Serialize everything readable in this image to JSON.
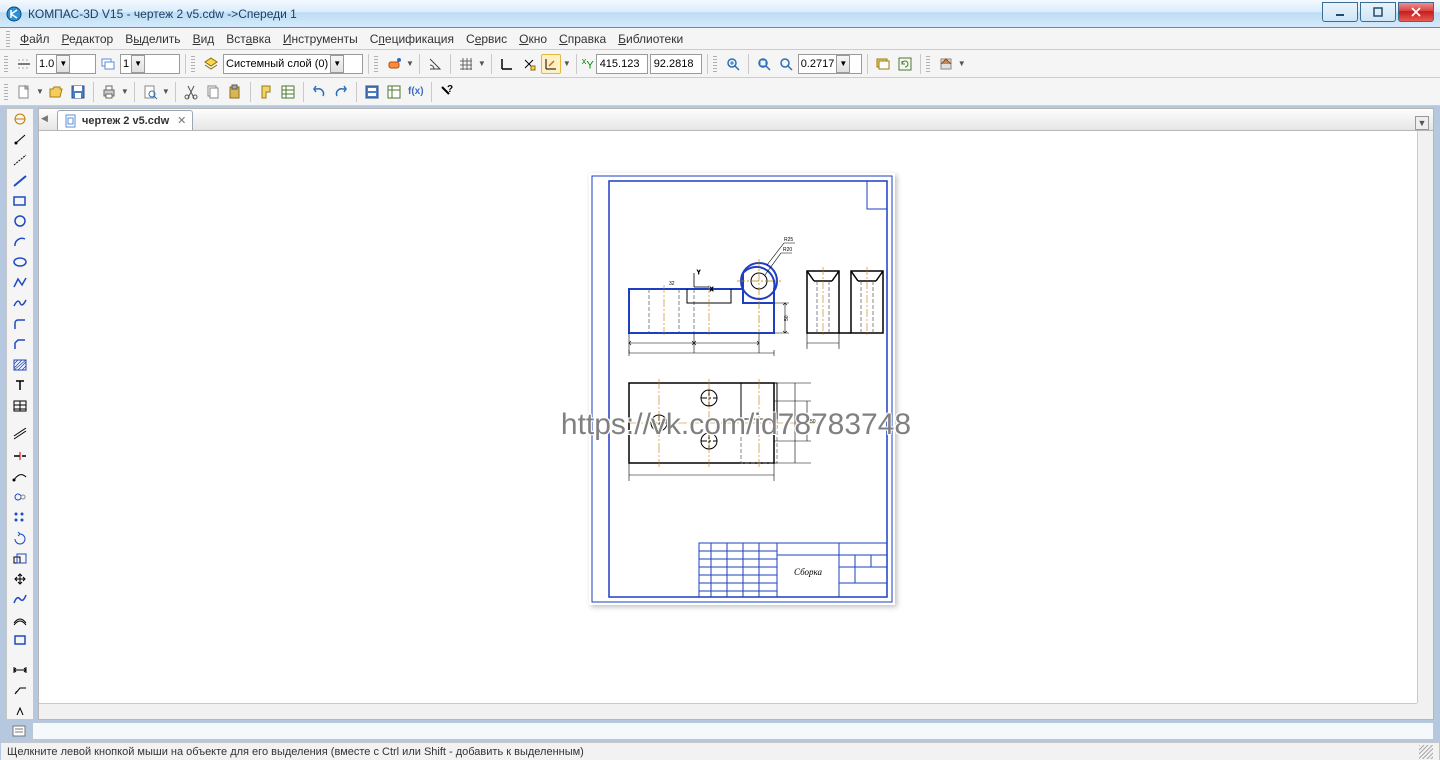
{
  "window": {
    "title": "КОМПАС-3D V15 - чертеж 2 v5.cdw ->Спереди 1"
  },
  "menu": {
    "file": "Файл",
    "edit": "Редактор",
    "select": "Выделить",
    "view": "Вид",
    "insert": "Вставка",
    "tools": "Инструменты",
    "spec": "Спецификация",
    "service": "Сервис",
    "window": "Окно",
    "help": "Справка",
    "libs": "Библиотеки"
  },
  "toolbar1": {
    "lineweight": "1.0",
    "layer_num": "1",
    "layer_name": "Системный слой (0)",
    "coord_x": "415.123",
    "coord_y": "92.2818",
    "zoom": "0.2717"
  },
  "tab": {
    "name": "чертеж 2 v5.cdw"
  },
  "drawing": {
    "title_block_label": "Сборка",
    "watermark": "https://vk.com/id78783748",
    "radius1": "R25",
    "radius2": "R20",
    "dim_50": "50",
    "dim_50b": "50"
  },
  "status": {
    "text": "Щелкните левой кнопкой мыши на объекте для его выделения (вместе с Ctrl или Shift - добавить к выделенным)"
  }
}
